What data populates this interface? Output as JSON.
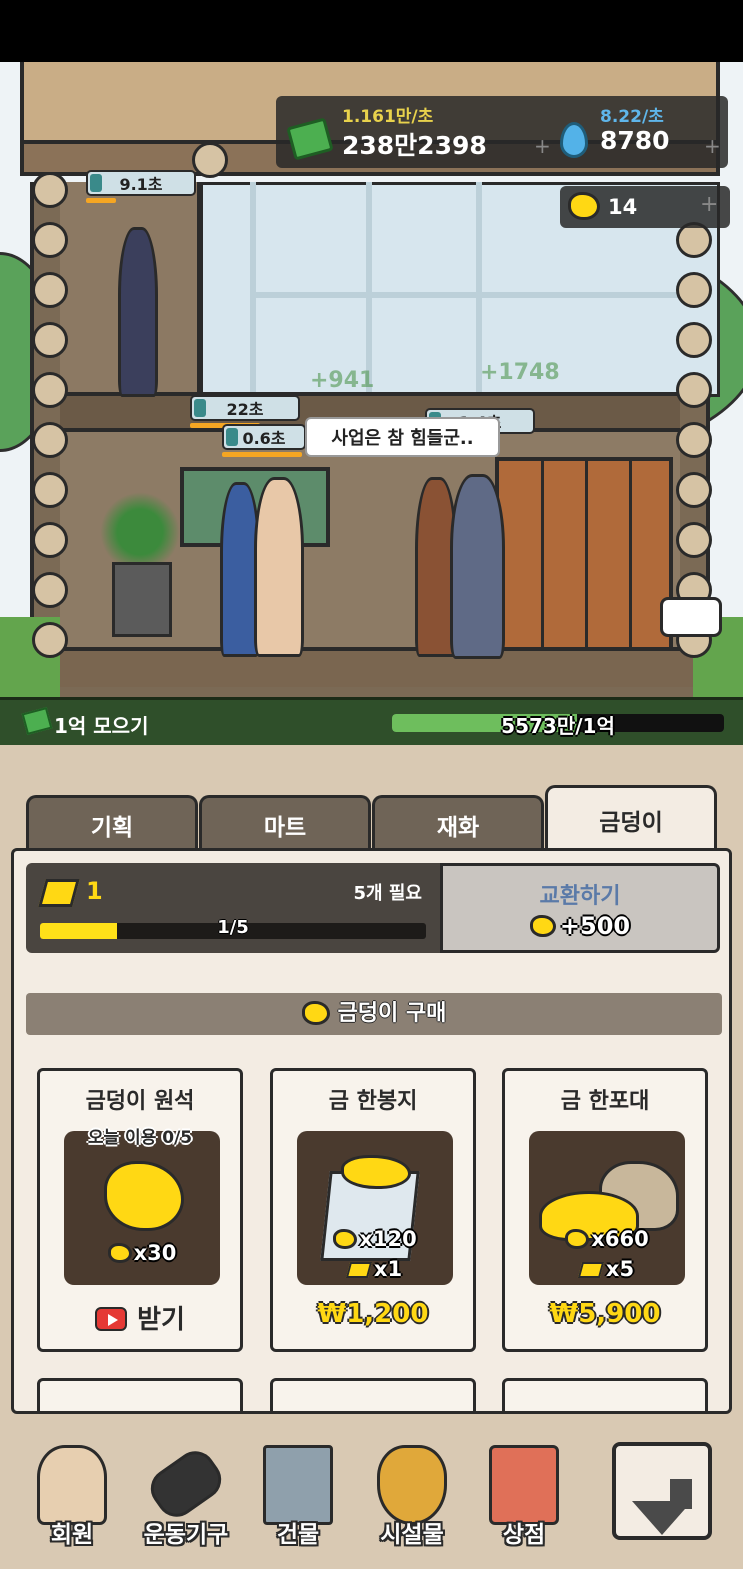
{
  "resources": {
    "cash_rate": "1.161만/초",
    "cash": "238만2398",
    "water_rate": "8.22/초",
    "water": "8780",
    "gold": "14",
    "plus": "+"
  },
  "scene": {
    "timers": [
      "9.1초",
      "22초",
      "0.6초",
      "1.4초"
    ],
    "floating_texts": [
      "+941",
      "+1748"
    ],
    "speech": "사업은 참 힘들군.."
  },
  "goal": {
    "label": "1억 모으기",
    "progress_text": "5573만/1억",
    "progress_fraction": 0.557
  },
  "tabs": [
    {
      "label": "기획",
      "active": false
    },
    {
      "label": "마트",
      "active": false
    },
    {
      "label": "재화",
      "active": false
    },
    {
      "label": "금덩이",
      "active": true
    }
  ],
  "exchange": {
    "bar_count": "1",
    "need_text": "5개 필요",
    "progress_text": "1/5",
    "progress_fraction": 0.2,
    "button_label": "교환하기",
    "button_reward": "+500"
  },
  "shop": {
    "section_title": "금덩이 구매",
    "cards": [
      {
        "title": "금덩이 원석",
        "daily": "오늘 이용 0/5",
        "reward_gold": "x30",
        "action": "받기"
      },
      {
        "title": "금 한봉지",
        "reward_gold": "x120",
        "reward_bar": "x1",
        "price": "₩1,200"
      },
      {
        "title": "금 한포대",
        "reward_gold": "x660",
        "reward_bar": "x5",
        "price": "₩5,900"
      }
    ]
  },
  "nav": [
    {
      "label": "회원",
      "icon": "muscle-man-icon"
    },
    {
      "label": "운동기구",
      "icon": "dumbbell-icon"
    },
    {
      "label": "건물",
      "icon": "building-icon"
    },
    {
      "label": "시설물",
      "icon": "trophy-icon"
    },
    {
      "label": "상점",
      "icon": "shop-icon"
    }
  ],
  "colors": {
    "gold": "#ffd814",
    "cash_green": "#4caf50",
    "water_blue": "#53b2e8",
    "panel_bg": "#f3ece3",
    "tab_bg": "#6f6457"
  }
}
